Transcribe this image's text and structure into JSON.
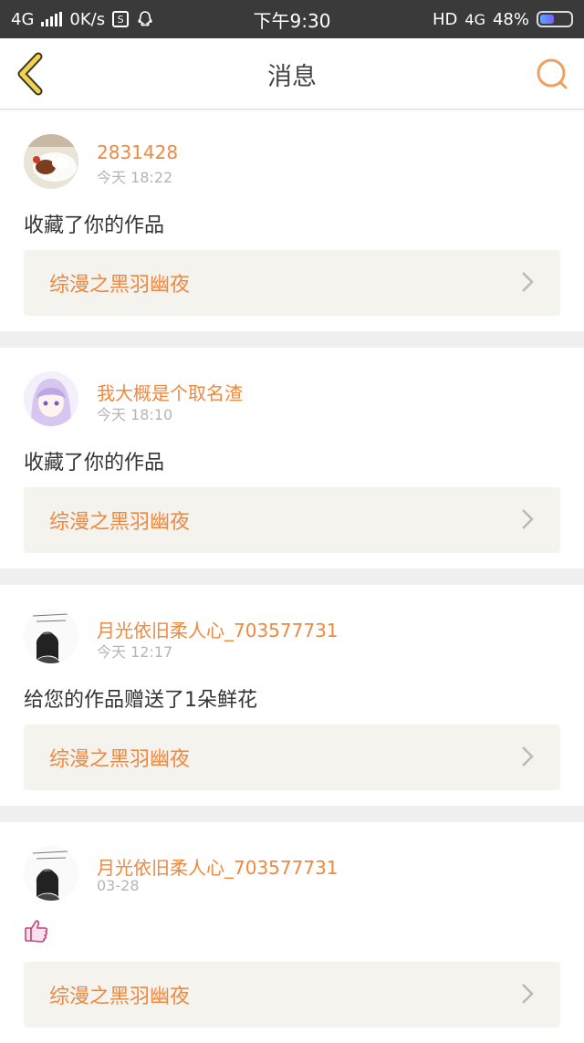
{
  "statusbar": {
    "network": "4G",
    "speed": "0K/s",
    "s_icon_text": "S",
    "time": "下午9:30",
    "hd": "HD",
    "net_right": "4G",
    "battery": "48%",
    "battery_level": 0.48
  },
  "navbar": {
    "title": "消息",
    "back_icon": "chevron-left-icon",
    "search_icon": "search-icon"
  },
  "messages": [
    {
      "name": "2831428",
      "time": "今天 18:22",
      "text": "收藏了你的作品",
      "work_title": "综漫之黑羽幽夜",
      "avatar": "food-photo"
    },
    {
      "name": "我大概是个取名渣",
      "time": "今天 18:10",
      "text": "收藏了你的作品",
      "work_title": "综漫之黑羽幽夜",
      "avatar": "anime-girl"
    },
    {
      "name": "月光依旧柔人心_703577731",
      "time": "今天 12:17",
      "text": "给您的作品赠送了1朵鲜花",
      "work_title": "综漫之黑羽幽夜",
      "avatar": "sketch-girl"
    },
    {
      "name": "月光依旧柔人心_703577731",
      "time": "03-28",
      "text": "",
      "emoji": "thumbs-up-icon",
      "work_title": "综漫之黑羽幽夜",
      "avatar": "sketch-girl"
    }
  ]
}
